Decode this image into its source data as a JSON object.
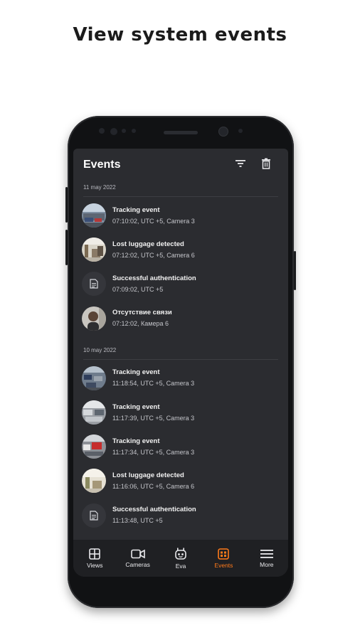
{
  "headline": "View system events",
  "appbar": {
    "title": "Events",
    "filter_icon": "filter-icon",
    "delete_icon": "trash-icon"
  },
  "groups": [
    {
      "date": "11 may 2022",
      "events": [
        {
          "title": "Tracking event",
          "subtitle": "07:10:02, UTC +5, Camera  3",
          "thumb": "street-cars"
        },
        {
          "title": "Lost luggage detected",
          "subtitle": "07:12:02, UTC +5, Camera 6",
          "thumb": "hall"
        },
        {
          "title": "Successful authentication",
          "subtitle": "07:09:02, UTC +5",
          "thumb": "document-icon"
        },
        {
          "title": "Отсутствие связи",
          "subtitle": "07:12:02, Камера 6",
          "thumb": "person"
        }
      ]
    },
    {
      "date": "10 may 2022",
      "events": [
        {
          "title": "Tracking event",
          "subtitle": "11:18:54, UTC +5, Camera  3",
          "thumb": "street-cars"
        },
        {
          "title": "Tracking event",
          "subtitle": "11:17:39, UTC +5, Camera  3",
          "thumb": "parking"
        },
        {
          "title": "Tracking event",
          "subtitle": "11:17:34, UTC +5, Camera  3",
          "thumb": "red-car"
        },
        {
          "title": "Lost luggage detected",
          "subtitle": "11:16:06, UTC +5, Camera 6",
          "thumb": "hall"
        },
        {
          "title": "Successful authentication",
          "subtitle": "11:13:48, UTC +5",
          "thumb": "document-icon"
        }
      ]
    }
  ],
  "nav": [
    {
      "label": "Views",
      "icon": "grid-icon",
      "active": false
    },
    {
      "label": "Cameras",
      "icon": "video-camera-icon",
      "active": false
    },
    {
      "label": "Eva",
      "icon": "robot-icon",
      "active": false
    },
    {
      "label": "Events",
      "icon": "events-icon",
      "active": true
    },
    {
      "label": "More",
      "icon": "menu-icon",
      "active": false
    }
  ],
  "colors": {
    "accent": "#ff7a1a",
    "screen_bg": "#2b2c30",
    "nav_bg": "#1f2023"
  }
}
